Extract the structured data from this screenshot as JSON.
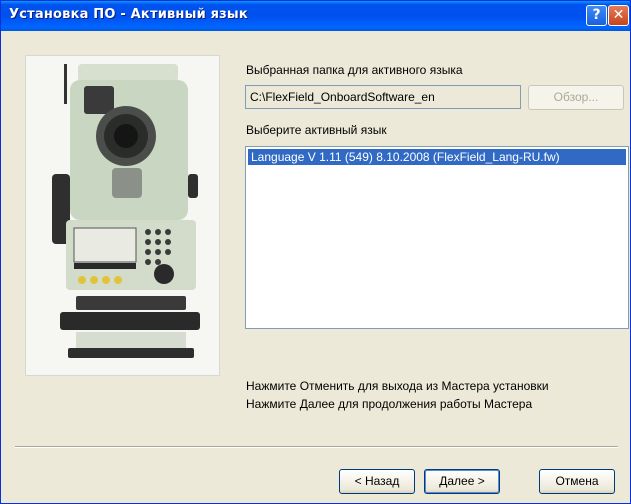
{
  "window": {
    "title": "Установка ПО - Активный язык",
    "help_symbol": "?",
    "close_symbol": "✕"
  },
  "folder": {
    "label": "Выбранная папка для активного языка",
    "value": "C:\\FlexField_OnboardSoftware_en",
    "browse_label": "Обзор..."
  },
  "language": {
    "label": "Выберите активный язык",
    "items": [
      "Language V 1.11 (549) 8.10.2008 (FlexField_Lang-RU.fw)"
    ],
    "selected_index": 0
  },
  "instructions": {
    "line1": "Нажмите Отменить для выхода из Мастера установки",
    "line2": "Нажмите Далее для продолжения работы Мастера"
  },
  "buttons": {
    "back": "< Назад",
    "next": "Далее >",
    "cancel": "Отмена"
  },
  "colors": {
    "titlebar": "#0053ee",
    "selection": "#316ac5",
    "dialog_bg": "#ece9d8"
  },
  "image": {
    "icon": "total-station-instrument"
  }
}
